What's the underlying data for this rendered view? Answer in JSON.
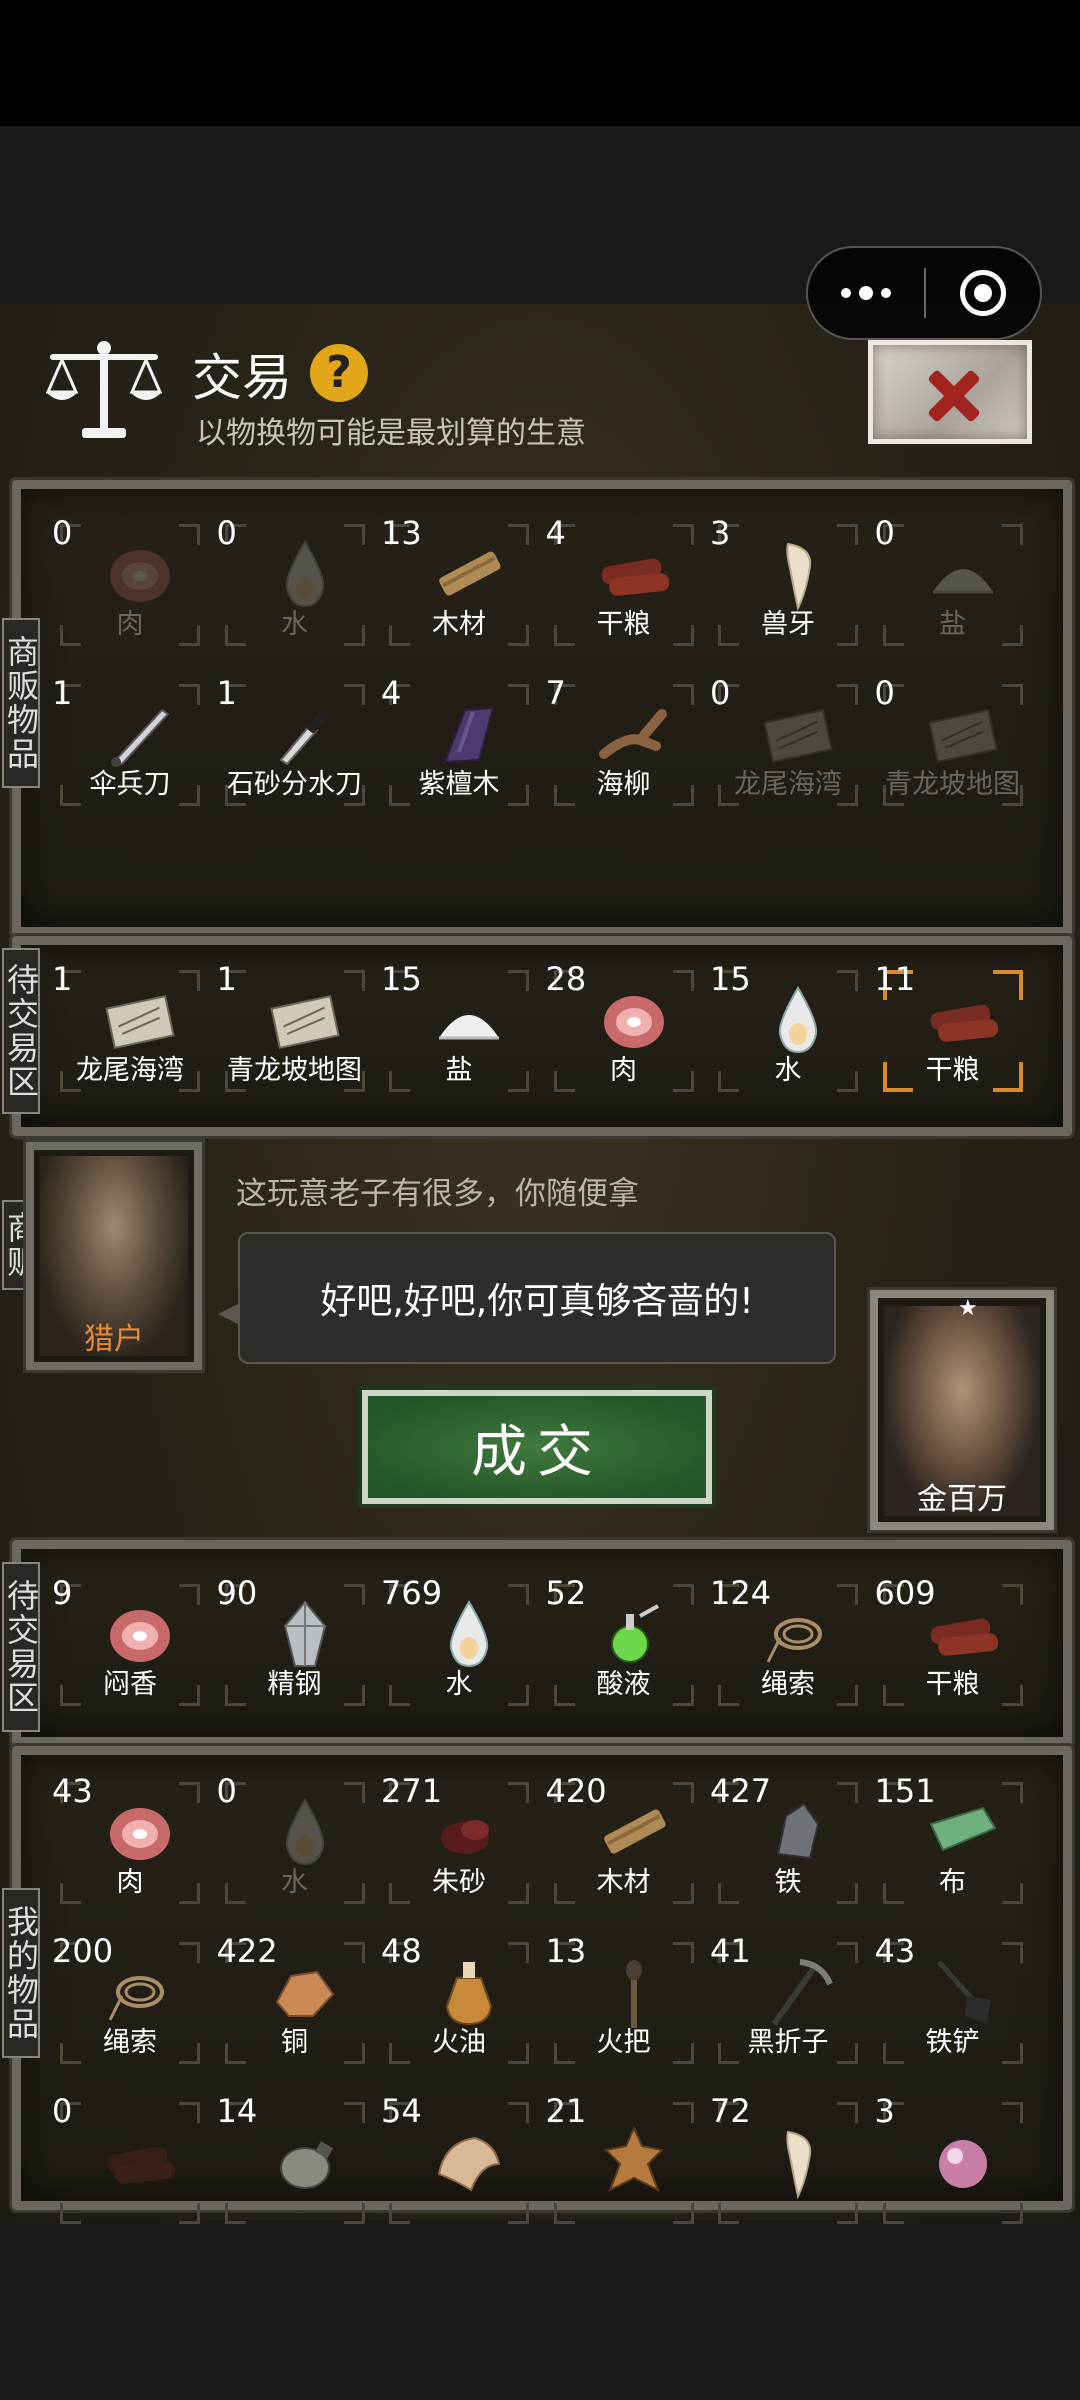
{
  "capsule": {
    "more_icon": "more-dots-icon",
    "close_icon": "target-close-icon"
  },
  "header": {
    "title": "交易",
    "help": "?",
    "subtitle": "以物换物可能是最划算的生意"
  },
  "labels": {
    "vendor_items": "商贩物品",
    "pending_top": "待交易区",
    "vendor": "商贩",
    "pending_bottom": "待交易区",
    "my_items": "我的物品"
  },
  "vendor_items": [
    {
      "count": "0",
      "name": "肉",
      "icon": "meat",
      "empty": true
    },
    {
      "count": "0",
      "name": "水",
      "icon": "water",
      "empty": true
    },
    {
      "count": "13",
      "name": "木材",
      "icon": "wood"
    },
    {
      "count": "4",
      "name": "干粮",
      "icon": "jerky"
    },
    {
      "count": "3",
      "name": "兽牙",
      "icon": "fang"
    },
    {
      "count": "0",
      "name": "盐",
      "icon": "salt",
      "empty": true
    },
    {
      "count": "1",
      "name": "伞兵刀",
      "icon": "knife"
    },
    {
      "count": "1",
      "name": "石砂分水刀",
      "icon": "blade"
    },
    {
      "count": "4",
      "name": "紫檀木",
      "icon": "purplewood"
    },
    {
      "count": "7",
      "name": "海柳",
      "icon": "branch"
    },
    {
      "count": "0",
      "name": "龙尾海湾",
      "icon": "map",
      "empty": true
    },
    {
      "count": "0",
      "name": "青龙坡地图",
      "icon": "map",
      "empty": true
    }
  ],
  "pending_vendor": [
    {
      "count": "1",
      "name": "龙尾海湾",
      "icon": "map"
    },
    {
      "count": "1",
      "name": "青龙坡地图",
      "icon": "map"
    },
    {
      "count": "15",
      "name": "盐",
      "icon": "salt"
    },
    {
      "count": "28",
      "name": "肉",
      "icon": "meat"
    },
    {
      "count": "15",
      "name": "水",
      "icon": "water"
    },
    {
      "count": "11",
      "name": "干粮",
      "icon": "jerky",
      "selected": true
    }
  ],
  "vendor_area": {
    "hunter_name": "猎户",
    "line": "这玩意老子有很多，你随便拿",
    "bubble": "好吧,好吧,你可真够吝啬的!",
    "deal_button": "成交",
    "player_name": "金百万",
    "player_star": "★"
  },
  "pending_mine": [
    {
      "count": "9",
      "name": "闷香",
      "icon": "meat"
    },
    {
      "count": "90",
      "name": "精钢",
      "icon": "steel"
    },
    {
      "count": "769",
      "name": "水",
      "icon": "water"
    },
    {
      "count": "52",
      "name": "酸液",
      "icon": "potion"
    },
    {
      "count": "124",
      "name": "绳索",
      "icon": "rope"
    },
    {
      "count": "609",
      "name": "干粮",
      "icon": "jerky"
    }
  ],
  "my_items": [
    {
      "count": "43",
      "name": "肉",
      "icon": "meat"
    },
    {
      "count": "0",
      "name": "水",
      "icon": "water",
      "empty": true
    },
    {
      "count": "271",
      "name": "朱砂",
      "icon": "cinnabar"
    },
    {
      "count": "420",
      "name": "木材",
      "icon": "wood"
    },
    {
      "count": "427",
      "name": "铁",
      "icon": "iron"
    },
    {
      "count": "151",
      "name": "布",
      "icon": "cloth"
    },
    {
      "count": "200",
      "name": "绳索",
      "icon": "rope"
    },
    {
      "count": "422",
      "name": "铜",
      "icon": "copper"
    },
    {
      "count": "48",
      "name": "火油",
      "icon": "oil"
    },
    {
      "count": "13",
      "name": "火把",
      "icon": "torch"
    },
    {
      "count": "41",
      "name": "黑折子",
      "icon": "pick"
    },
    {
      "count": "43",
      "name": "铁铲",
      "icon": "shovel"
    },
    {
      "count": "0",
      "name": "",
      "icon": "jerky",
      "empty": true
    },
    {
      "count": "14",
      "name": "",
      "icon": "flask"
    },
    {
      "count": "54",
      "name": "",
      "icon": "hide"
    },
    {
      "count": "21",
      "name": "",
      "icon": "pelt"
    },
    {
      "count": "72",
      "name": "",
      "icon": "fang"
    },
    {
      "count": "3",
      "name": "",
      "icon": "pearl"
    }
  ]
}
